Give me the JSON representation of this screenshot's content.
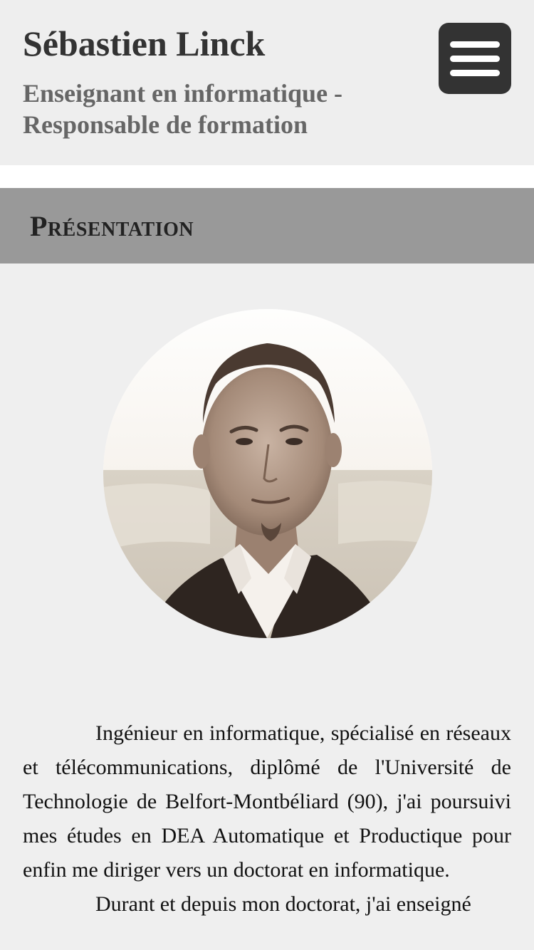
{
  "header": {
    "title": "Sébastien Linck",
    "subtitle": "Enseignant en informatique - Responsable de formation"
  },
  "menu": {
    "icon": "hamburger-menu-icon"
  },
  "section": {
    "title": "Présentation"
  },
  "profile": {
    "photo_icon": "profile-photo"
  },
  "content": {
    "paragraphs": [
      "Ingénieur en informatique, spécialisé en réseaux et télécommunications, diplômé de l'Université de Technologie de Belfort-Montbéliard (90), j'ai poursuivi mes études en DEA Automatique et Productique pour enfin me diriger vers un doctorat en informatique.",
      "Durant et depuis mon doctorat, j'ai enseigné"
    ]
  }
}
